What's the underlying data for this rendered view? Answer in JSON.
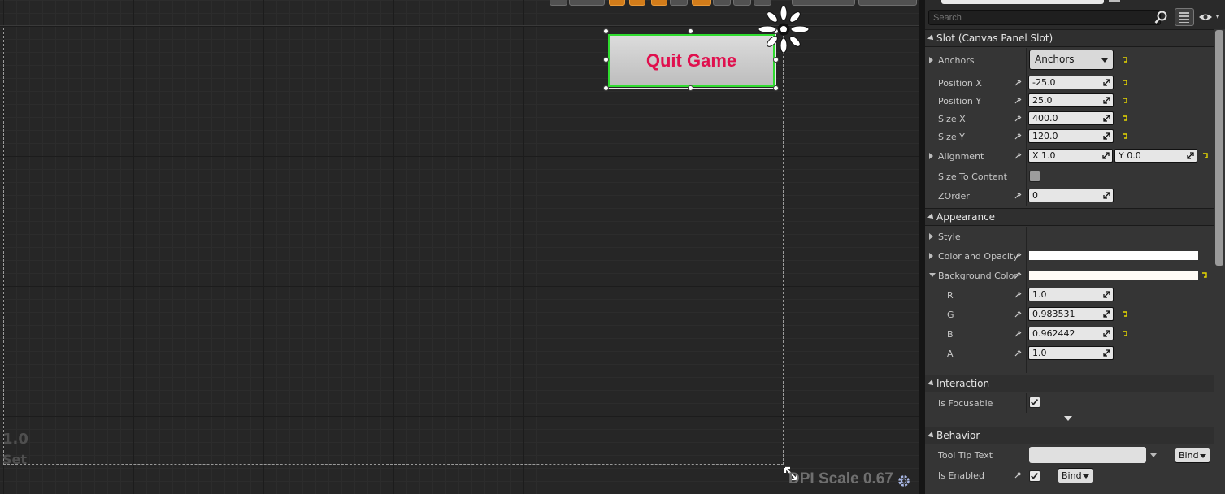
{
  "designer": {
    "widget_button_label": "Quit Game",
    "overlay_scale_text": "1.0",
    "overlay_set_text": "Set",
    "dpi_scale_text": "DPI Scale 0.67"
  },
  "details": {
    "search_placeholder": "Search",
    "slot": {
      "header": "Slot (Canvas Panel Slot)",
      "anchors_label": "Anchors",
      "anchors_value": "Anchors",
      "position_x_label": "Position X",
      "position_x_value": "-25.0",
      "position_y_label": "Position Y",
      "position_y_value": "25.0",
      "size_x_label": "Size X",
      "size_x_value": "400.0",
      "size_y_label": "Size Y",
      "size_y_value": "120.0",
      "alignment_label": "Alignment",
      "alignment_x": "X 1.0",
      "alignment_y": "Y 0.0",
      "size_to_content_label": "Size To Content",
      "size_to_content_checked": false,
      "zorder_label": "ZOrder",
      "zorder_value": "0"
    },
    "appearance": {
      "header": "Appearance",
      "style_label": "Style",
      "color_opacity_label": "Color and Opacity",
      "color_opacity_value": "#ffffff",
      "background_color_label": "Background Color",
      "background_color_value": "#fffbf5",
      "r_label": "R",
      "r_value": "1.0",
      "g_label": "G",
      "g_value": "0.983531",
      "b_label": "B",
      "b_value": "0.962442",
      "a_label": "A",
      "a_value": "1.0"
    },
    "interaction": {
      "header": "Interaction",
      "is_focusable_label": "Is Focusable",
      "is_focusable_checked": true
    },
    "behavior": {
      "header": "Behavior",
      "tooltip_label": "Tool Tip Text",
      "tooltip_value": "",
      "tooltip_bind": "Bind",
      "is_enabled_label": "Is Enabled",
      "is_enabled_checked": true,
      "is_enabled_bind": "Bind"
    }
  },
  "colors": {
    "selection_outline": "#2fdc2f",
    "button_text": "#e0104e",
    "toolbar_orange": "#d27c1a",
    "reset_arrow": "#e6d800"
  },
  "icons": [
    "anchor-icon",
    "resize-icon",
    "gear-icon",
    "search-icon",
    "grid-view-icon",
    "eye-icon",
    "reset-arrow-icon",
    "pin-icon",
    "spin-arrows-icon",
    "checkmark-icon"
  ]
}
